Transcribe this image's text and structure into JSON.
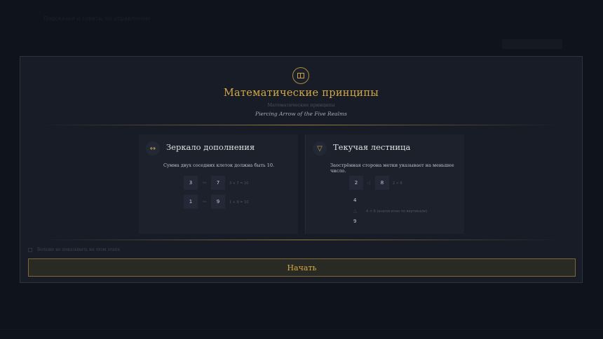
{
  "background": {
    "top_text": "Подсказки и советы по управлению"
  },
  "dialog": {
    "title": "Математические принципы",
    "subtitle": "Математические принципы",
    "campaign": "Piercing Arrow of the Five Realms",
    "emblem_icon": "book-icon",
    "accent_color": "#c9a24b"
  },
  "cards": [
    {
      "icon": "↔",
      "icon_name": "double-arrow-icon",
      "title": "Зеркало дополнения",
      "description": "Сумма двух соседних клеток должна быть 10.",
      "examples": [
        {
          "a": "3",
          "connector": "↔",
          "b": "7",
          "note": "3 + 7 = 10"
        },
        {
          "a": "1",
          "connector": "↔",
          "b": "9",
          "note": "1 + 9 = 10"
        }
      ]
    },
    {
      "icon": "▽",
      "icon_name": "triangle-down-icon",
      "title": "Текучая лестница",
      "description": "Заострённая сторона метки указывает на меньшее число.",
      "horizontal": {
        "a": "2",
        "connector": "◁",
        "b": "8",
        "note": "2 < 8"
      },
      "vertical": {
        "a": "4",
        "connector": "△",
        "b": "9",
        "note": "4 < 9 (аналогично по вертикали)"
      }
    }
  ],
  "checkbox": {
    "label": "Больше не показывать на этом этапе",
    "checked": false
  },
  "start_button": {
    "label": "Начать"
  }
}
